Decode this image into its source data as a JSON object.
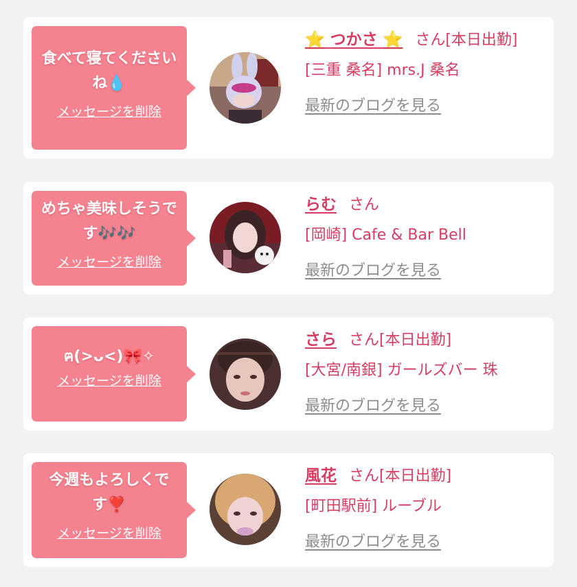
{
  "colors": {
    "page_bg": "#f2f1f4",
    "bubble": "#f4828f",
    "accent_text": "#d63d63",
    "link_gray": "#8c8c8c"
  },
  "common": {
    "delete_label": "メッセージを削除",
    "blog_label": "最新のブログを見る"
  },
  "cards": [
    {
      "message": "食べて寝てくださいね💧",
      "name_prefix": "⭐",
      "name": "つかさ",
      "name_suffix_star": "⭐",
      "suffix": "さん[本日出勤]",
      "shop": "[三重 桑名] mrs.J 桑名"
    },
    {
      "message": "めちゃ美味しそうです🎶🎶",
      "name": "らむ",
      "suffix": "さん",
      "shop": "[岡崎] Cafe & Bar Bell"
    },
    {
      "message": "ฅ(>ᴗ<)🎀✧",
      "name": "さら",
      "suffix": "さん[本日出勤]",
      "shop": "[大宮/南銀] ガールズバー 珠"
    },
    {
      "message": "今週もよろしくです❣️",
      "name": "風花",
      "suffix": "さん[本日出勤]",
      "shop": "[町田駅前] ルーブル"
    }
  ]
}
